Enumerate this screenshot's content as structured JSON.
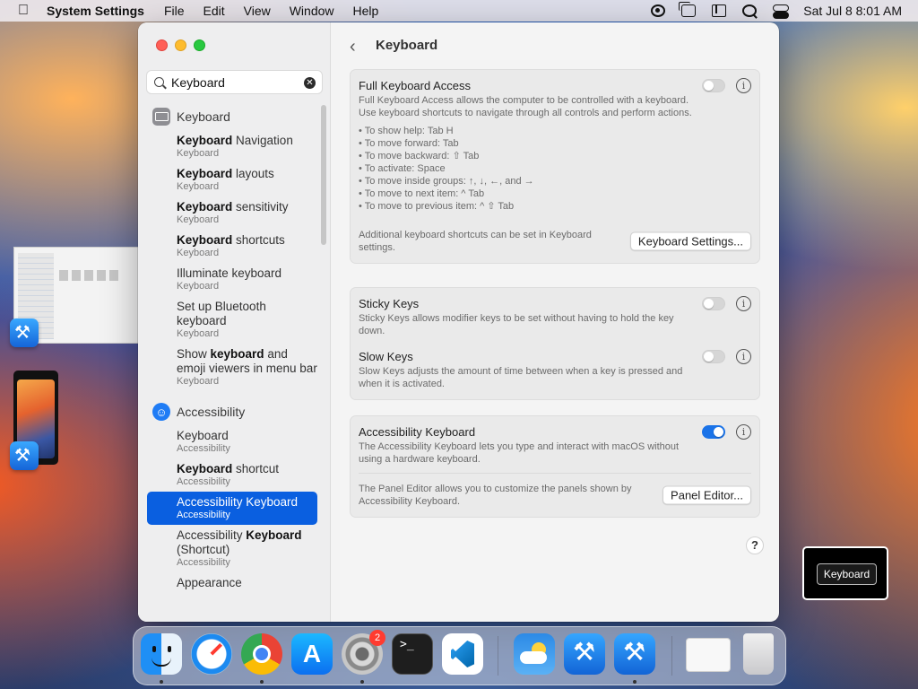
{
  "menubar": {
    "app_name": "System Settings",
    "menus": [
      "File",
      "Edit",
      "View",
      "Window",
      "Help"
    ],
    "clock": "Sat Jul 8  8:01 AM"
  },
  "window": {
    "search": {
      "value": "Keyboard"
    },
    "sidebar": {
      "keyboard_category": "Keyboard",
      "keyboard_results": [
        {
          "match": "Keyboard",
          "rest": " Navigation",
          "section": "Keyboard"
        },
        {
          "match": "Keyboard",
          "rest": " layouts",
          "section": "Keyboard"
        },
        {
          "match": "Keyboard",
          "rest": " sensitivity",
          "section": "Keyboard"
        },
        {
          "match": "Keyboard",
          "rest": " shortcuts",
          "section": "Keyboard"
        },
        {
          "pre": "Illuminate keyboard",
          "section": "Keyboard"
        },
        {
          "pre": "Set up Bluetooth keyboard",
          "section": "Keyboard"
        },
        {
          "pre": "Show ",
          "match": "keyboard",
          "rest": " and emoji viewers in menu bar",
          "section": "Keyboard"
        }
      ],
      "accessibility_category": "Accessibility",
      "accessibility_results": [
        {
          "pre": "Keyboard",
          "section": "Accessibility"
        },
        {
          "match": "Keyboard",
          "rest": " shortcut",
          "section": "Accessibility"
        },
        {
          "pre": "Accessibility Keyboard",
          "section": "Accessibility",
          "selected": true
        },
        {
          "pre": "Accessibility ",
          "match": "Keyboard",
          "rest": " (Shortcut)",
          "section": "Accessibility"
        },
        {
          "pre": "Appearance"
        }
      ]
    },
    "title": "Keyboard",
    "fka": {
      "title": "Full Keyboard Access",
      "desc": "Full Keyboard Access allows the computer to be controlled with a keyboard. Use keyboard shortcuts to navigate through all controls and perform actions.",
      "list": [
        "• To show help: Tab H",
        "• To move forward: Tab",
        "• To move backward: ⇧ Tab",
        "• To activate: Space",
        "• To move inside groups: ↑, ↓, ←, and →",
        "• To move to next item: ^ Tab",
        "• To move to previous item: ^ ⇧ Tab"
      ],
      "enabled": false,
      "footer": "Additional keyboard shortcuts can be set in Keyboard settings.",
      "button": "Keyboard Settings..."
    },
    "sticky": {
      "title": "Sticky Keys",
      "desc": "Sticky Keys allows modifier keys to be set without having to hold the key down.",
      "enabled": false
    },
    "slow": {
      "title": "Slow Keys",
      "desc": "Slow Keys adjusts the amount of time between when a key is pressed and when it is activated.",
      "enabled": false
    },
    "acc_kbd": {
      "title": "Accessibility Keyboard",
      "desc": "The Accessibility Keyboard lets you type and interact with macOS without using a hardware keyboard.",
      "enabled": true,
      "footer": "The Panel Editor allows you to customize the panels shown by Accessibility Keyboard.",
      "button": "Panel Editor..."
    },
    "help": "?"
  },
  "hud": {
    "label": "Keyboard"
  },
  "dock": {
    "badge": "2",
    "apps": [
      "finder-icon",
      "safari-icon",
      "chrome-icon",
      "app-store-icon",
      "system-settings-icon",
      "terminal-icon",
      "vscode-icon",
      "weather-icon",
      "xcode-icon",
      "simulator-icon",
      "document-preview-icon",
      "trash-icon"
    ]
  },
  "colors": {
    "accent": "#0a5fe0",
    "toggle_on": "#1a73e8"
  }
}
